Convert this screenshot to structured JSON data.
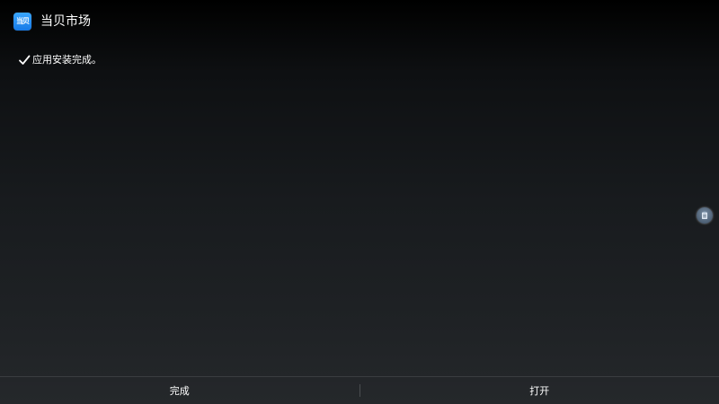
{
  "app": {
    "icon_name": "dangbei-app-icon",
    "icon_text": "当贝",
    "title": "当贝市场"
  },
  "status": {
    "icon_name": "checkmark-icon",
    "message": "应用安装完成。"
  },
  "float_button": {
    "icon_name": "clipboard-icon"
  },
  "actions": {
    "done_label": "完成",
    "open_label": "打开"
  },
  "colors": {
    "background_top": "#000000",
    "background_bottom": "#25282b",
    "icon_accent": "#1679e6",
    "text": "#ffffff"
  }
}
